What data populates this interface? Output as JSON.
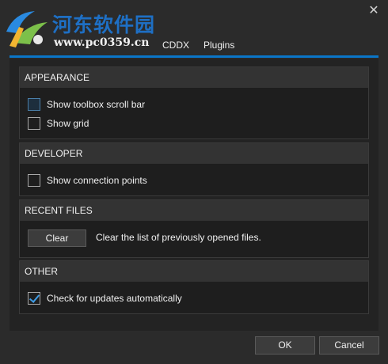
{
  "window": {
    "close_glyph": "✕"
  },
  "watermark": {
    "title": "河东软件园",
    "url": "www.pc0359.cn"
  },
  "tabs": [
    {
      "label": "CDDX"
    },
    {
      "label": "Plugins",
      "active": true
    }
  ],
  "accent_color": "#0a76c8",
  "sections": {
    "appearance": {
      "header": "APPEARANCE",
      "options": [
        {
          "label": "Show toolbox scroll bar",
          "checked": false
        },
        {
          "label": "Show grid",
          "checked": false
        }
      ]
    },
    "developer": {
      "header": "DEVELOPER",
      "options": [
        {
          "label": "Show connection points",
          "checked": false
        }
      ]
    },
    "recent_files": {
      "header": "RECENT FILES",
      "clear_label": "Clear",
      "clear_description": "Clear the list of previously opened files."
    },
    "other": {
      "header": "OTHER",
      "options": [
        {
          "label": "Check for updates automatically",
          "checked": true
        }
      ]
    }
  },
  "footer": {
    "ok_label": "OK",
    "cancel_label": "Cancel"
  }
}
